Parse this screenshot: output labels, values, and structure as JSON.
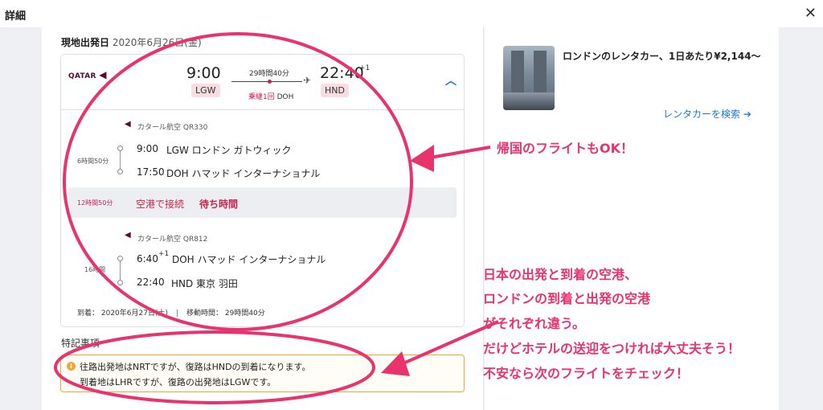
{
  "topbar": {
    "title": "詳細",
    "close_glyph": "✕"
  },
  "departure": {
    "label": "現地出発日",
    "date": "2020年6月26日(金)"
  },
  "summary": {
    "airline_logo": "QATAR",
    "dep_time": "9:00",
    "dep_airport": "LGW",
    "duration": "29時間40分",
    "stops": "乗継1回",
    "stop_airport": "DOH",
    "arr_time": "22:40",
    "arr_plus": "+1",
    "arr_airport": "HND"
  },
  "segments": [
    {
      "airline": "カタール航空 QR330",
      "duration": "6時間50分",
      "dep_time": "9:00",
      "dep_place": "LGW ロンドン ガトウィック",
      "arr_time": "17:50",
      "arr_place": "DOH ハマッド インターナショナル"
    },
    {
      "airline": "カタール航空 QR812",
      "duration": "16時間",
      "dep_time": "6:40",
      "dep_plus": "+1",
      "dep_place": "DOH ハマッド インターナショナル",
      "arr_time": "22:40",
      "arr_place": "HND 東京 羽田"
    }
  ],
  "layover": {
    "time": "12時間50分",
    "label": "空港で接続",
    "wait": "待ち時間"
  },
  "arrival_info": {
    "arrival": "到着： 2020年6月27日(土)",
    "travel": "移動時間： 29時間40分"
  },
  "notes": {
    "title": "特記事項",
    "line1": "往路出発地はNRTですが、復路はHNDの到着になります。",
    "line2": "到着地はLHRですが、復路の出発地はLGWです。"
  },
  "rental": {
    "title": "ロンドンのレンタカー、1日あたり¥2,144〜",
    "link": "レンタカーを検索",
    "link_arrow": "➔"
  },
  "annotations": {
    "return_ok": "帰国のフライトもOK！",
    "lines": [
      "日本の出発と到着の空港、",
      "ロンドンの到着と出発の空港",
      "がそれぞれ違う。",
      "だけどホテルの送迎をつければ大丈夫そう！",
      "不安なら次のフライトをチェック！"
    ]
  },
  "colors": {
    "annotation": "#e8336d",
    "link": "#1a7ad8",
    "chip": "#f8dde3",
    "notes_border": "#f0a73a"
  }
}
